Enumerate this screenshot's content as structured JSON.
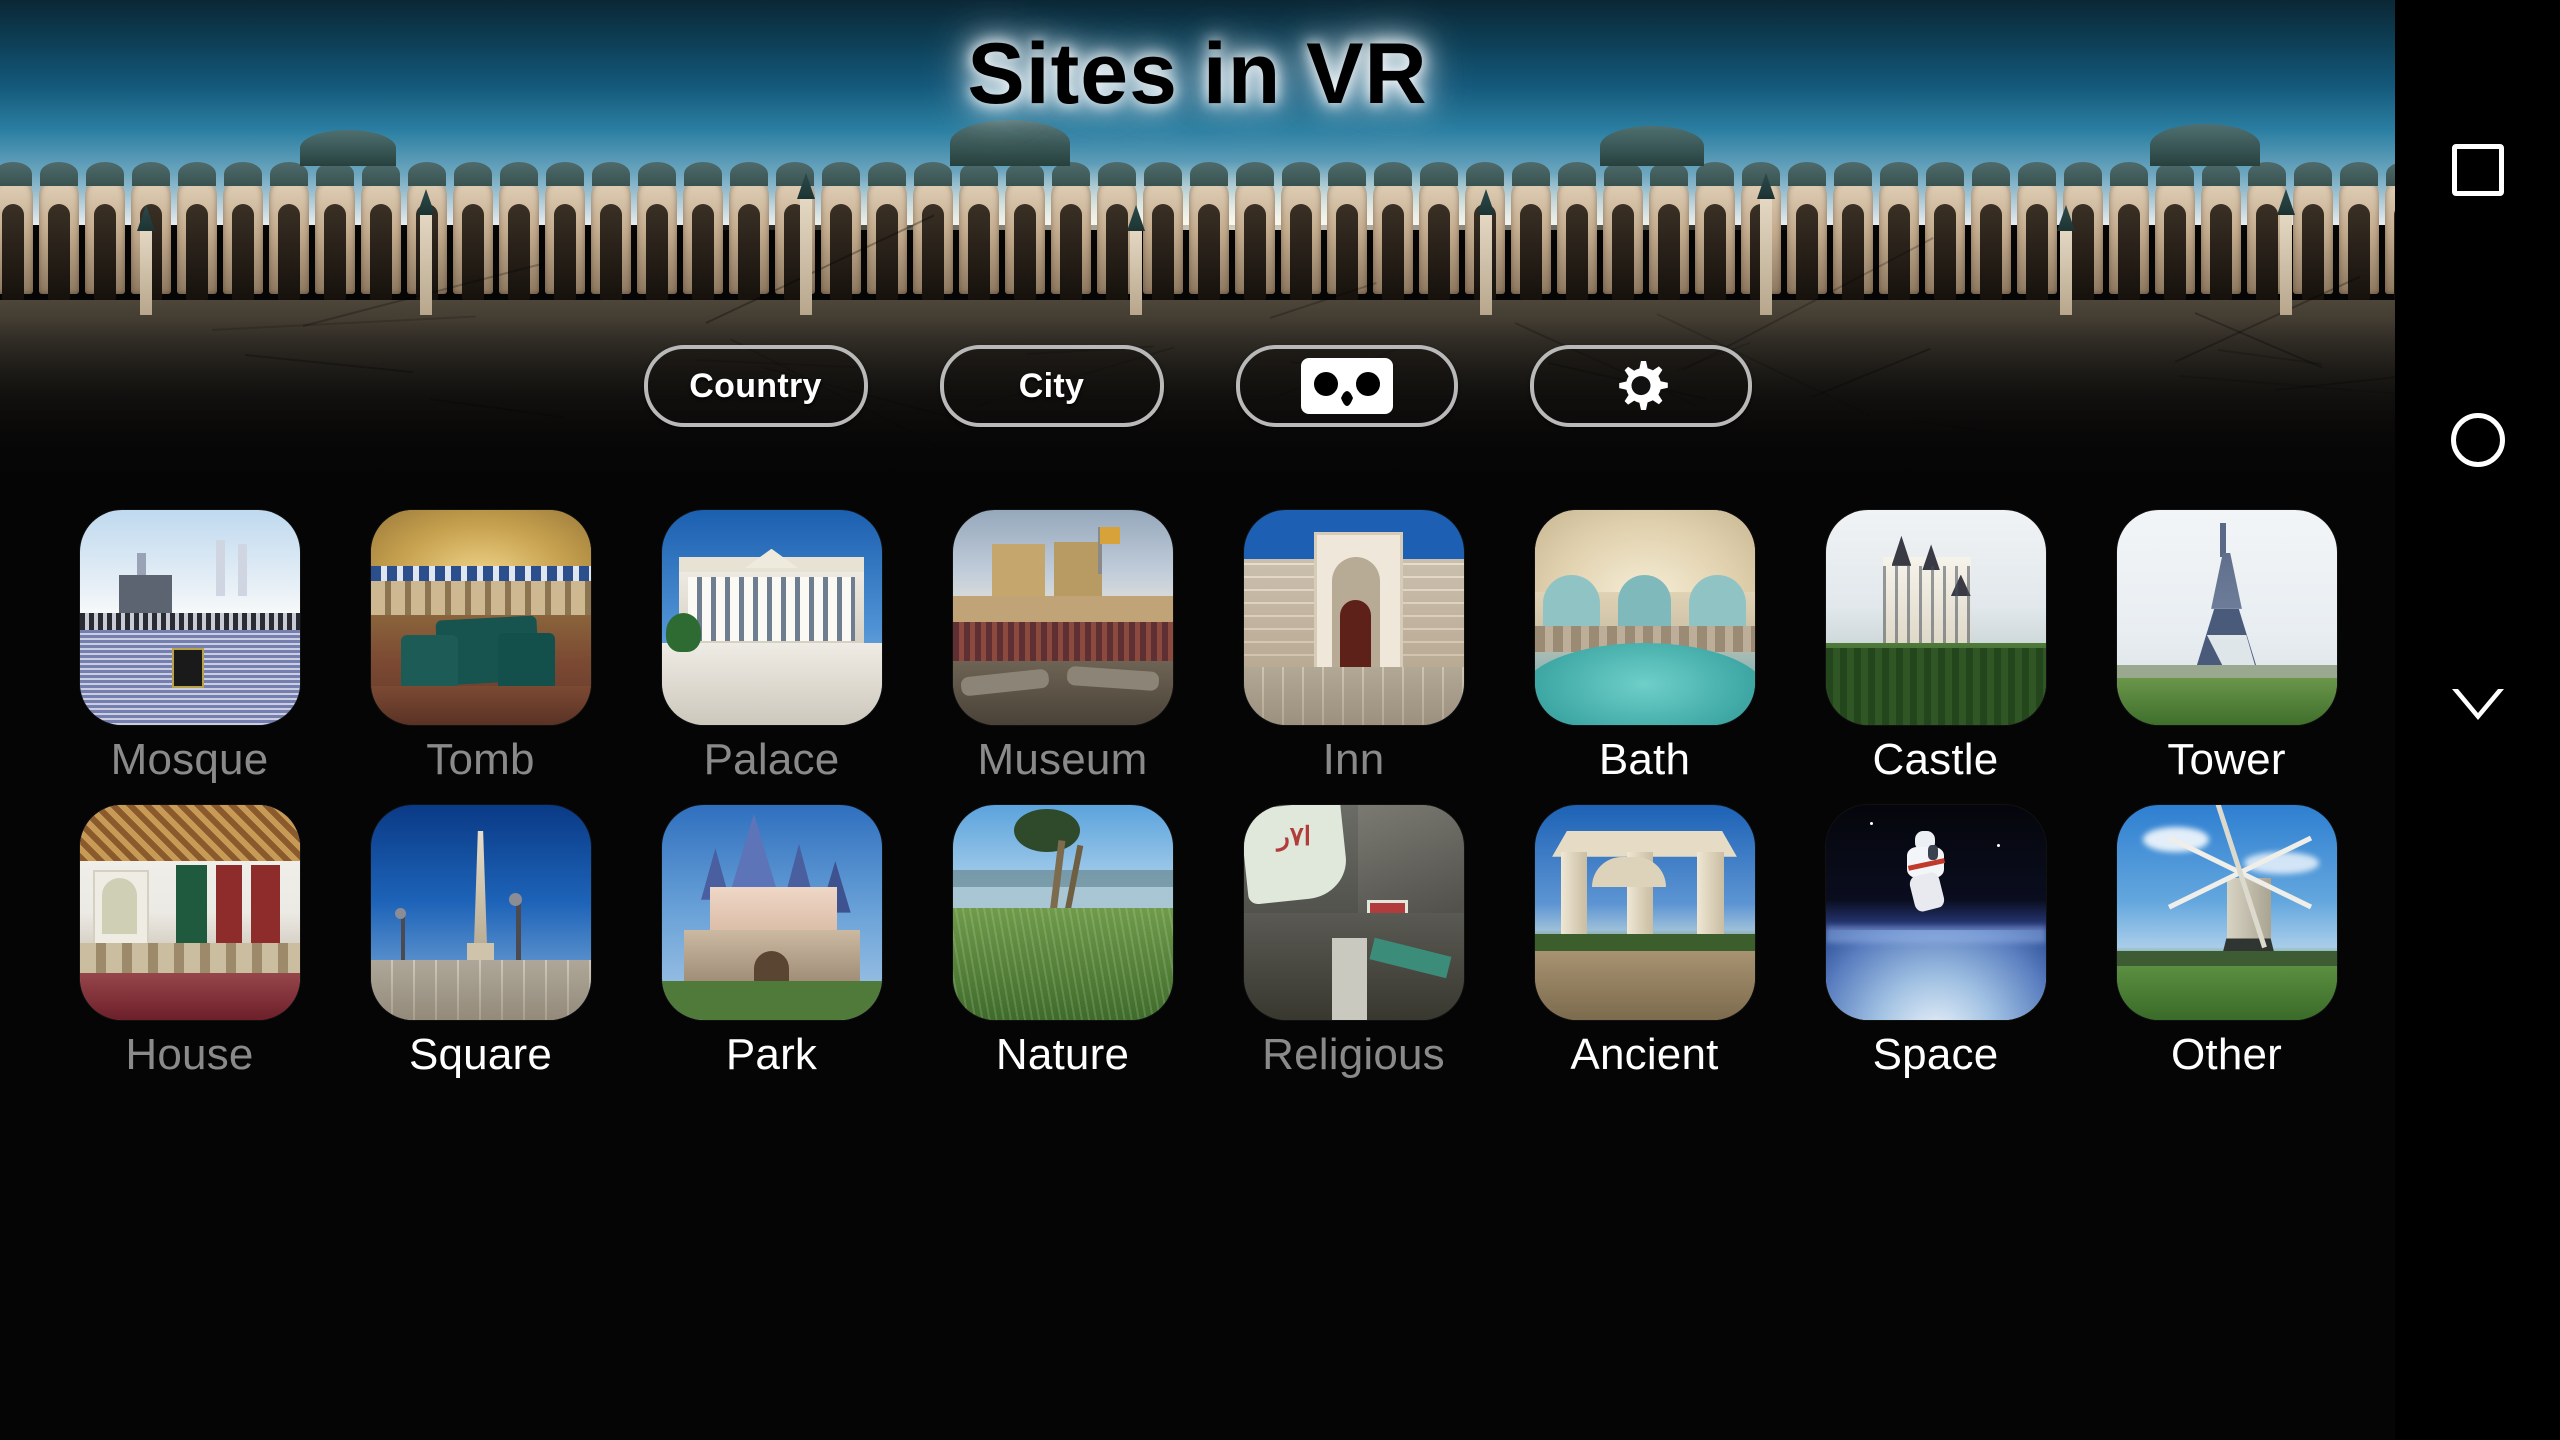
{
  "app": {
    "title": "Sites in VR"
  },
  "toolbar": {
    "buttons": [
      {
        "id": "country",
        "label": "Country",
        "kind": "text"
      },
      {
        "id": "city",
        "label": "City",
        "kind": "text"
      },
      {
        "id": "vr",
        "label": "",
        "kind": "icon",
        "icon": "cardboard-vr-icon"
      },
      {
        "id": "settings",
        "label": "",
        "kind": "icon",
        "icon": "gear-icon"
      }
    ]
  },
  "grid": {
    "rows": [
      [
        {
          "label": "Mosque",
          "enabled": false,
          "icon": "mosque-thumbnail"
        },
        {
          "label": "Tomb",
          "enabled": false,
          "icon": "tomb-thumbnail"
        },
        {
          "label": "Palace",
          "enabled": false,
          "icon": "palace-thumbnail"
        },
        {
          "label": "Museum",
          "enabled": false,
          "icon": "museum-thumbnail"
        },
        {
          "label": "Inn",
          "enabled": false,
          "icon": "inn-thumbnail"
        },
        {
          "label": "Bath",
          "enabled": true,
          "icon": "bath-thumbnail"
        },
        {
          "label": "Castle",
          "enabled": true,
          "icon": "castle-thumbnail"
        },
        {
          "label": "Tower",
          "enabled": true,
          "icon": "tower-thumbnail"
        }
      ],
      [
        {
          "label": "House",
          "enabled": false,
          "icon": "house-thumbnail"
        },
        {
          "label": "Square",
          "enabled": true,
          "icon": "square-thumbnail"
        },
        {
          "label": "Park",
          "enabled": true,
          "icon": "park-thumbnail"
        },
        {
          "label": "Nature",
          "enabled": true,
          "icon": "nature-thumbnail"
        },
        {
          "label": "Religious",
          "enabled": false,
          "icon": "religious-thumbnail"
        },
        {
          "label": "Ancient",
          "enabled": true,
          "icon": "ancient-thumbnail"
        },
        {
          "label": "Space",
          "enabled": true,
          "icon": "space-thumbnail"
        },
        {
          "label": "Other",
          "enabled": true,
          "icon": "other-thumbnail"
        }
      ]
    ]
  },
  "navbar": {
    "items": [
      {
        "id": "recents",
        "icon": "square-recents-icon"
      },
      {
        "id": "home",
        "icon": "circle-home-icon"
      },
      {
        "id": "back",
        "icon": "triangle-back-icon"
      }
    ]
  },
  "colors": {
    "background": "#050505",
    "label_enabled": "#ffffff",
    "label_disabled": "#8a8a8a",
    "pill_border": "#b9b9b9",
    "sky_top": "#0b2735"
  }
}
